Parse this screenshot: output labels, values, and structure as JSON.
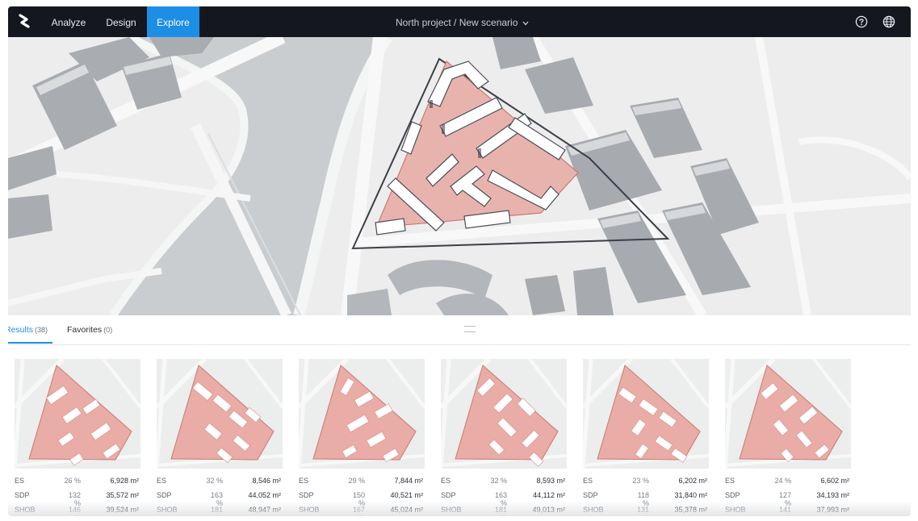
{
  "nav": {
    "items": [
      "Analyze",
      "Design",
      "Explore"
    ],
    "active": "Explore"
  },
  "project": {
    "title": "North project / New scenario"
  },
  "colors": {
    "accent": "#1d8ee6",
    "topbar": "#14171d",
    "parcel": "#e8b1ab"
  },
  "icons": {
    "logo": "logo-icon",
    "help": "help-icon",
    "language": "globe-icon",
    "dropdown": "chevron-down-icon"
  },
  "tabs": [
    {
      "label": "Results",
      "count": "(38)"
    },
    {
      "label": "Favorites",
      "count": "(0)"
    }
  ],
  "results": [
    {
      "rows": [
        {
          "k": "ES",
          "p": "26 %",
          "v": "6,928 m²"
        },
        {
          "k": "SDP",
          "p": "132 %",
          "v": "35,572 m²"
        },
        {
          "k": "SHOB",
          "p": "146 %",
          "v": "39,524 m²"
        }
      ]
    },
    {
      "rows": [
        {
          "k": "ES",
          "p": "32 %",
          "v": "8,546 m²"
        },
        {
          "k": "SDP",
          "p": "163 %",
          "v": "44,052 m²"
        },
        {
          "k": "SHOB",
          "p": "181 %",
          "v": "48,947 m²"
        }
      ]
    },
    {
      "rows": [
        {
          "k": "ES",
          "p": "29 %",
          "v": "7,844 m²"
        },
        {
          "k": "SDP",
          "p": "150 %",
          "v": "40,521 m²"
        },
        {
          "k": "SHOB",
          "p": "167 %",
          "v": "45,024 m²"
        }
      ]
    },
    {
      "rows": [
        {
          "k": "ES",
          "p": "32 %",
          "v": "8,593 m²"
        },
        {
          "k": "SDP",
          "p": "163 %",
          "v": "44,112 m²"
        },
        {
          "k": "SHOB",
          "p": "181 %",
          "v": "49,013 m²"
        }
      ]
    },
    {
      "rows": [
        {
          "k": "ES",
          "p": "23 %",
          "v": "6,202 m²"
        },
        {
          "k": "SDP",
          "p": "118 %",
          "v": "31,840 m²"
        },
        {
          "k": "SHOB",
          "p": "131 %",
          "v": "35,378 m²"
        }
      ]
    },
    {
      "rows": [
        {
          "k": "ES",
          "p": "24 %",
          "v": "6,602 m²"
        },
        {
          "k": "SDP",
          "p": "127 %",
          "v": "34,193 m²"
        },
        {
          "k": "SHOB",
          "p": "141 %",
          "v": "37,993 m²"
        }
      ]
    }
  ]
}
